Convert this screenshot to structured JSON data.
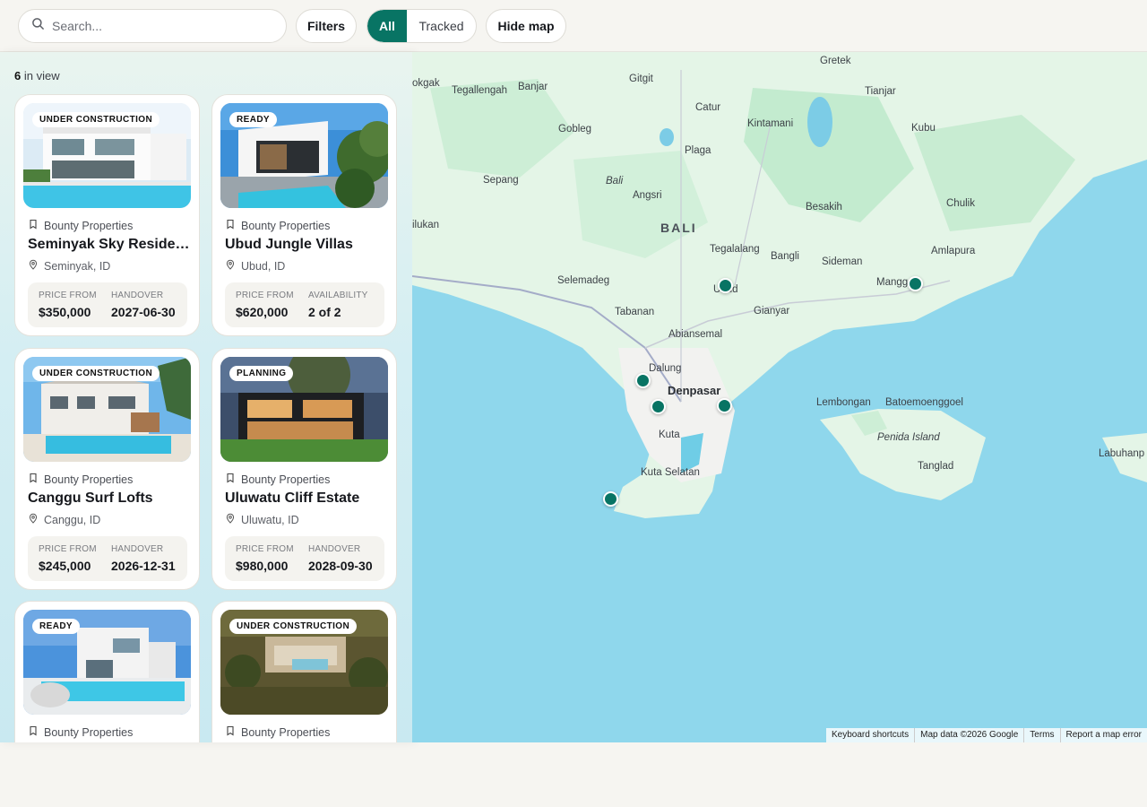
{
  "toolbar": {
    "search_placeholder": "Search...",
    "filters_label": "Filters",
    "segment": {
      "all": "All",
      "tracked": "Tracked",
      "selected": "All"
    },
    "hide_map_label": "Hide map"
  },
  "results": {
    "count": "6",
    "suffix": "in view"
  },
  "listings": [
    {
      "status": "UNDER CONSTRUCTION",
      "developer": "Bounty Properties",
      "title": "Seminyak Sky Residences",
      "location": "Seminyak, ID",
      "stat1_label": "PRICE FROM",
      "stat1_value": "$350,000",
      "stat2_label": "HANDOVER",
      "stat2_value": "2027-06-30"
    },
    {
      "status": "READY",
      "developer": "Bounty Properties",
      "title": "Ubud Jungle Villas",
      "location": "Ubud, ID",
      "stat1_label": "PRICE FROM",
      "stat1_value": "$620,000",
      "stat2_label": "AVAILABILITY",
      "stat2_value": "2 of 2"
    },
    {
      "status": "UNDER CONSTRUCTION",
      "developer": "Bounty Properties",
      "title": "Canggu Surf Lofts",
      "location": "Canggu, ID",
      "stat1_label": "PRICE FROM",
      "stat1_value": "$245,000",
      "stat2_label": "HANDOVER",
      "stat2_value": "2026-12-31"
    },
    {
      "status": "PLANNING",
      "developer": "Bounty Properties",
      "title": "Uluwatu Cliff Estate",
      "location": "Uluwatu, ID",
      "stat1_label": "PRICE FROM",
      "stat1_value": "$980,000",
      "stat2_label": "HANDOVER",
      "stat2_value": "2028-09-30"
    },
    {
      "status": "READY",
      "developer": "Bounty Properties"
    },
    {
      "status": "UNDER CONSTRUCTION",
      "developer": "Bounty Properties"
    }
  ],
  "map": {
    "labels": {
      "gretek": "Gretek",
      "tianjar": "Tianjar",
      "kubu": "Kubu",
      "gitgit": "Gitgit",
      "catur": "Catur",
      "kintamani": "Kintamani",
      "tegallengah": "Tegallengah",
      "banjar": "Banjar",
      "okgak": "okgak",
      "gobleg": "Gobleg",
      "plaga": "Plaga",
      "sepang": "Sepang",
      "bali_it": "Bali",
      "angsri": "Angsri",
      "besakih": "Besakih",
      "chulik": "Chulik",
      "bali": "BALI",
      "ilukan": "ilukan",
      "tegalalang": "Tegalalang",
      "bangli": "Bangli",
      "sideman": "Sideman",
      "amlapura": "Amlapura",
      "selemadeg": "Selemadeg",
      "ubud": "Ubud",
      "mangg": "Mangg",
      "tabanan": "Tabanan",
      "gianyar": "Gianyar",
      "abiansemal": "Abiansemal",
      "dalung": "Dalung",
      "denpasar": "Denpasar",
      "lembongan": "Lembongan",
      "batoe": "Batoemoenggoel",
      "kuta": "Kuta",
      "penida": "Penida Island",
      "kuta_selatan": "Kuta Selatan",
      "tanglad": "Tanglad",
      "labuhan": "Labuhanp"
    },
    "attribution": [
      "Keyboard shortcuts",
      "Map data ©2026 Google",
      "Terms",
      "Report a map error"
    ]
  },
  "colors": {
    "accent": "#087464",
    "land": "#e4f5e7",
    "sea": "#8fd7ec",
    "forest": "#c3ebcf"
  }
}
